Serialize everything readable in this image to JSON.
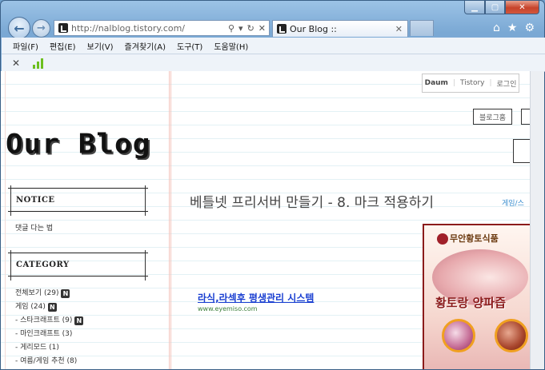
{
  "browser": {
    "address_url": "http://nalblog.tistory.com/",
    "tab_title": "Our Blog ::",
    "menu": [
      "파일(F)",
      "편집(E)",
      "보기(V)",
      "즐겨찾기(A)",
      "도구(T)",
      "도움말(H)"
    ]
  },
  "page": {
    "top_links": {
      "daum": "Daum",
      "tistory": "Tistory",
      "login": "로그인"
    },
    "blog_title": "Our Blog",
    "sidebar_right": {
      "blog_home": "블로그홈"
    },
    "notice": {
      "heading": "NOTICE",
      "items": [
        "댓글 다는 법"
      ]
    },
    "category": {
      "heading": "CATEGORY",
      "items": [
        {
          "label": "전체보기 (29)",
          "new": true
        },
        {
          "label": "게임 (24)",
          "new": true
        },
        {
          "label": "- 스타크래프트 (9)",
          "new": true
        },
        {
          "label": "- 마인크래프트 (3)",
          "new": false
        },
        {
          "label": "- 게리모드 (1)",
          "new": false
        },
        {
          "label": "- 여름/게임 추천 (8)",
          "new": false
        }
      ],
      "new_badge": "N"
    },
    "post": {
      "title": "베틀넷 프리서버 만들기 - 8. 마크 적용하기",
      "category_link": "게임/스"
    },
    "ad": {
      "link_text": "라식,라섹후 평생관리 시스템",
      "url": "www.eyemiso.com",
      "banner_brand": "무안황토식품",
      "banner_slogan": "황토랑 양파즙"
    }
  },
  "colors": {
    "link_blue": "#1a3fd1",
    "category_blue": "#3a8ecf",
    "banner_red": "#8b1b1b"
  }
}
